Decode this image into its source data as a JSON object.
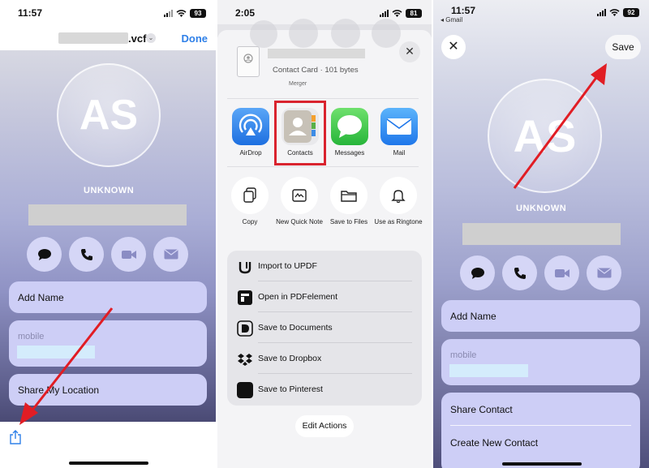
{
  "panel1": {
    "status": {
      "time": "11:57",
      "battery": "93"
    },
    "header": {
      "filename_suffix": ".vcf",
      "chevron": "⌄",
      "done_label": "Done"
    },
    "contact": {
      "initials": "AS",
      "unknown_label": "UNKNOWN",
      "actions": [
        {
          "icon": "message-icon"
        },
        {
          "icon": "phone-icon"
        },
        {
          "icon": "video-icon"
        },
        {
          "icon": "mail-icon"
        }
      ],
      "add_name_label": "Add Name",
      "mobile_label": "mobile",
      "share_location_label": "Share My Location"
    },
    "bottom": {
      "share_icon": "share-icon"
    },
    "arrow_color": "#e11d24"
  },
  "panel2": {
    "status": {
      "time": "2:05",
      "battery": "81"
    },
    "file": {
      "meta": "Contact Card · 101 bytes",
      "merger_text": "Merger"
    },
    "close_glyph": "✕",
    "apps": [
      {
        "label": "AirDrop",
        "icon": "airdrop-icon"
      },
      {
        "label": "Contacts",
        "icon": "contacts-icon",
        "highlighted": true
      },
      {
        "label": "Messages",
        "icon": "messages-icon"
      },
      {
        "label": "Mail",
        "icon": "mail-icon"
      }
    ],
    "ops": [
      {
        "label": "Copy",
        "icon": "copy-icon"
      },
      {
        "label": "New Quick Note",
        "icon": "quick-note-icon"
      },
      {
        "label": "Save to Files",
        "icon": "folder-icon"
      },
      {
        "label": "Use as Ringtone",
        "icon": "bell-icon"
      }
    ],
    "list": [
      {
        "label": "Import to UPDF",
        "icon": "updf-icon"
      },
      {
        "label": "Open in PDFelement",
        "icon": "pdfelement-icon"
      },
      {
        "label": "Save to Documents",
        "icon": "documents-icon"
      },
      {
        "label": "Save to Dropbox",
        "icon": "dropbox-icon"
      },
      {
        "label": "Save to Pinterest",
        "icon": "pinterest-icon"
      }
    ],
    "edit_actions_label": "Edit Actions",
    "highlight_color": "#d9232e"
  },
  "panel3": {
    "status": {
      "time": "11:57",
      "battery": "92",
      "back_app": "◂ Gmail"
    },
    "close_glyph": "✕",
    "save_label": "Save",
    "contact": {
      "initials": "AS",
      "unknown_label": "UNKNOWN",
      "add_name_label": "Add Name",
      "mobile_label": "mobile"
    },
    "actions": [
      {
        "label": "Share Contact"
      },
      {
        "label": "Create New Contact"
      }
    ],
    "arrow_color": "#e11d24"
  }
}
